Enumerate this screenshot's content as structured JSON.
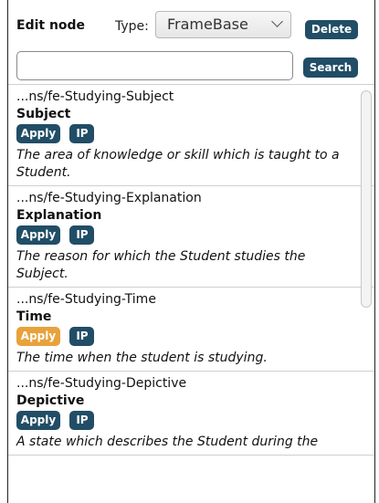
{
  "header": {
    "title": "Edit node",
    "type_label": "Type:",
    "type_value": "FrameBase",
    "delete_label": "Delete"
  },
  "search": {
    "value": "",
    "placeholder": "",
    "button_label": "Search"
  },
  "items": [
    {
      "uri": "...ns/fe-Studying-Subject",
      "name": "Subject",
      "apply_label": "Apply",
      "ip_label": "IP",
      "description": "The area of knowledge or skill which is taught to a Student."
    },
    {
      "uri": "...ns/fe-Studying-Explanation",
      "name": "Explanation",
      "apply_label": "Apply",
      "ip_label": "IP",
      "description": "The reason for which the Student studies the Subject."
    },
    {
      "uri": "...ns/fe-Studying-Time",
      "name": "Time",
      "apply_label": "Apply",
      "ip_label": "IP",
      "description": "The time when the student is studying."
    },
    {
      "uri": "...ns/fe-Studying-Depictive",
      "name": "Depictive",
      "apply_label": "Apply",
      "ip_label": "IP",
      "description": "A state which describes the Student during the"
    }
  ],
  "colors": {
    "button_bg": "#214d66",
    "button_active_bg": "#e8a23c"
  },
  "icons": {
    "type_dropdown": "chevron-down-icon"
  }
}
